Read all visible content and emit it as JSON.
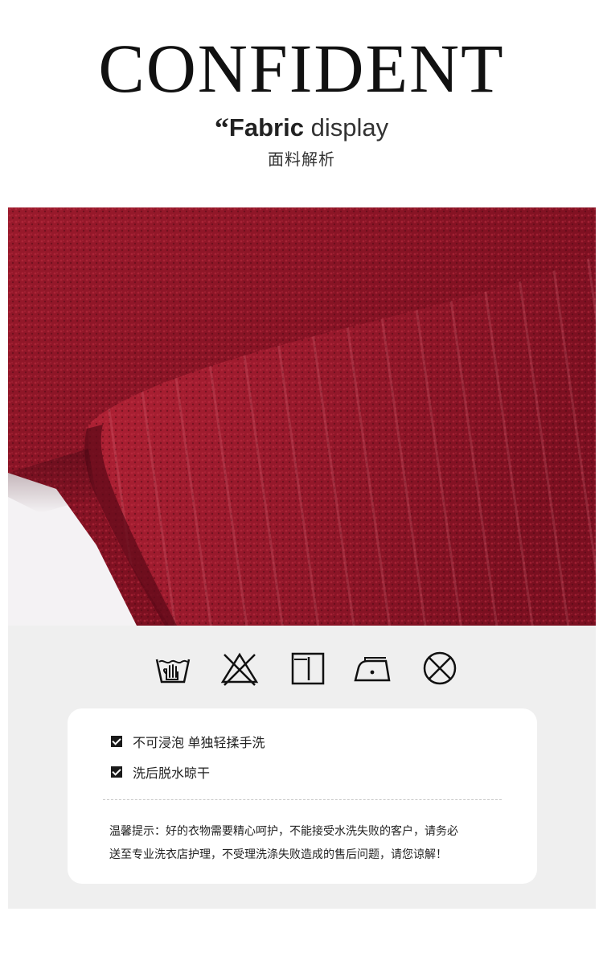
{
  "header": {
    "brand": "CONFIDENT",
    "quote_mark": "“",
    "subtitle_bold": "Fabric",
    "subtitle_light": "display",
    "subtitle_cn": "面料解析"
  },
  "photo": {
    "colors": {
      "fabric": "#8a1424",
      "fabric_dark": "#5a0a16",
      "fabric_light": "#b02236",
      "background": "#f4f2f4"
    }
  },
  "care": {
    "panel_bg": "#efefef",
    "icons": [
      "hand-wash-icon",
      "no-bleach-icon",
      "line-dry-icon",
      "low-iron-icon",
      "no-tumble-dry-icon"
    ],
    "items": [
      {
        "label": "不可浸泡 单独轻揉手洗",
        "checked": true
      },
      {
        "label": "洗后脱水晾干",
        "checked": true
      }
    ],
    "tip_line1": "温馨提示：好的衣物需要精心呵护，不能接受水洗失败的客户，请务必",
    "tip_line2": "送至专业洗衣店护理，不受理洗涤失败造成的售后问题，请您谅解！"
  }
}
